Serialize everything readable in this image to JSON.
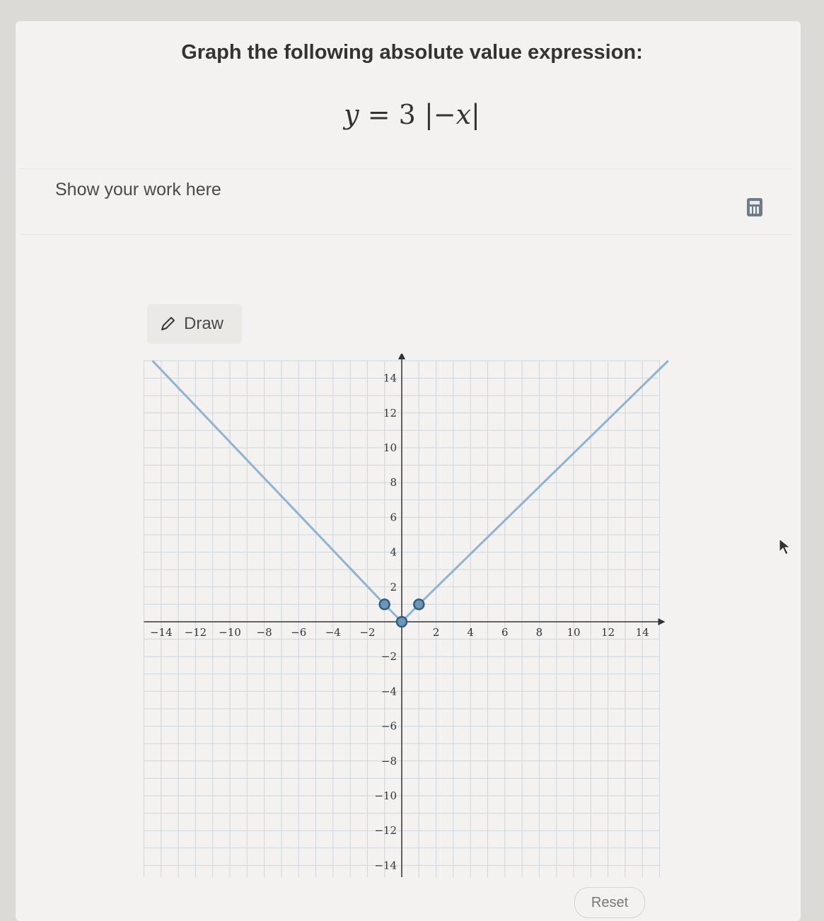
{
  "question": {
    "title": "Graph the following absolute value expression:",
    "equation": {
      "lhs": "y",
      "equals": "=",
      "coef": "3",
      "inner": "−x"
    }
  },
  "work": {
    "label": "Show your work here"
  },
  "toolbar": {
    "draw_label": "Draw",
    "draw_icon": "pencil-icon",
    "calc_icon": "calculator-icon"
  },
  "reset_label": "Reset",
  "colors": {
    "graph_line": "#8fb3d1",
    "point_fill": "#6f95b5",
    "point_stroke": "#2f5d83",
    "grid": "#cfd6dd",
    "axis": "#333333"
  },
  "chart_data": {
    "type": "line",
    "xlim": [
      -15,
      15
    ],
    "ylim": [
      -15,
      15
    ],
    "grid": true,
    "x_ticks": [
      -14,
      -12,
      -10,
      -8,
      -6,
      -4,
      -2,
      2,
      4,
      6,
      8,
      10,
      12,
      14
    ],
    "y_ticks": [
      14,
      12,
      10,
      8,
      6,
      4,
      2,
      -2,
      -4,
      -6,
      -8,
      -10,
      -12,
      -14
    ],
    "series": [
      {
        "points": [
          [
            -14.5,
            15
          ],
          [
            -1,
            1
          ],
          [
            0,
            0
          ],
          [
            1,
            1
          ],
          [
            15.5,
            15
          ]
        ]
      }
    ],
    "control_points": [
      [
        -1,
        1
      ],
      [
        0,
        0
      ],
      [
        1,
        1
      ]
    ]
  }
}
